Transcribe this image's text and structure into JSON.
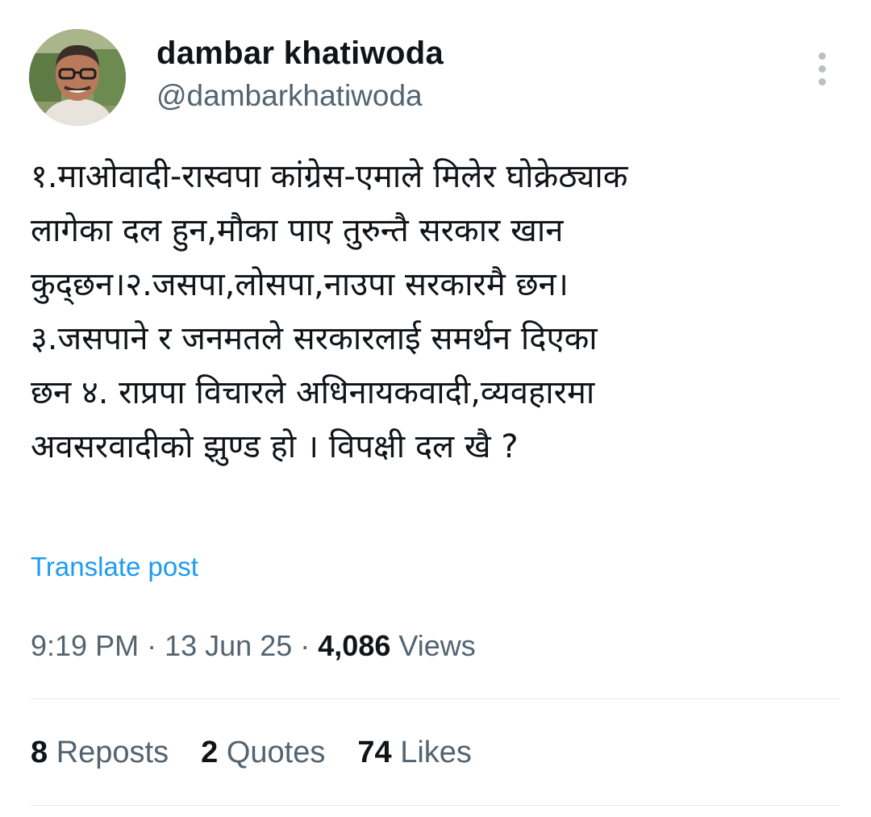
{
  "author": {
    "display_name": "dambar khatiwoda",
    "handle": "@dambarkhatiwoda"
  },
  "post": {
    "lines": [
      "१.माओवादी-रास्वपा कांग्रेस-एमाले मिलेर घोक्रेठ्याक",
      "लागेका दल हुन,मौका पाए तुरुन्तै सरकार खान",
      "कुद्छन।२.जसपा,लोसपा,नाउपा सरकारमै छन।",
      "३.जसपाने र जनमतले सरकारलाई समर्थन दिएका",
      "छन ४. राप्रपा विचारले अधिनायकवादी,व्यवहारमा",
      "अवसरवादीको झुण्ड हो । विपक्षी दल खै ?"
    ],
    "translate_label": "Translate post",
    "time": "9:19 PM",
    "date": "13 Jun 25",
    "separator": "·",
    "views_count": "4,086",
    "views_label": "Views"
  },
  "stats": {
    "reposts_count": "8",
    "reposts_label": "Reposts",
    "quotes_count": "2",
    "quotes_label": "Quotes",
    "likes_count": "74",
    "likes_label": "Likes"
  },
  "icons": {
    "more": "more-vertical-icon"
  },
  "colors": {
    "link": "#1d9bf0",
    "secondary_text": "#536471",
    "primary_text": "#0f1419"
  }
}
